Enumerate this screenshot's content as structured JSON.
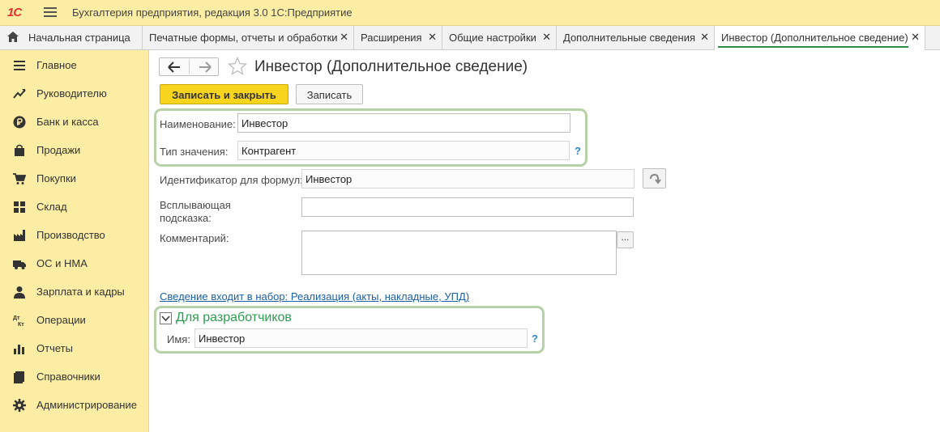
{
  "app": {
    "logo": "1С",
    "title": "Бухгалтерия предприятия, редакция 3.0 1С:Предприятие"
  },
  "tabs": [
    {
      "label": "Начальная страница"
    },
    {
      "label": "Печатные формы, отчеты и обработки"
    },
    {
      "label": "Расширения"
    },
    {
      "label": "Общие настройки"
    },
    {
      "label": "Дополнительные сведения"
    },
    {
      "label": "Инвестор (Дополнительное сведение)"
    }
  ],
  "tab_close_glyph": "✕",
  "sidebar": {
    "items": [
      {
        "label": "Главное",
        "icon": "list-icon"
      },
      {
        "label": "Руководителю",
        "icon": "trend-icon"
      },
      {
        "label": "Банк и касса",
        "icon": "ruble-icon"
      },
      {
        "label": "Продажи",
        "icon": "bag-icon"
      },
      {
        "label": "Покупки",
        "icon": "cart-icon"
      },
      {
        "label": "Склад",
        "icon": "warehouse-icon"
      },
      {
        "label": "Производство",
        "icon": "factory-icon"
      },
      {
        "label": "ОС и НМА",
        "icon": "truck-icon"
      },
      {
        "label": "Зарплата и кадры",
        "icon": "person-icon"
      },
      {
        "label": "Операции",
        "icon": "dt-kt-icon"
      },
      {
        "label": "Отчеты",
        "icon": "bar-chart-icon"
      },
      {
        "label": "Справочники",
        "icon": "book-icon"
      },
      {
        "label": "Администрирование",
        "icon": "gear-icon"
      }
    ],
    "dtkt_top": "Дт",
    "dtkt_bottom": "Кт"
  },
  "form": {
    "title": "Инвестор (Дополнительное сведение)",
    "save_close_label": "Записать и закрыть",
    "save_label": "Записать",
    "name_label": "Наименование:",
    "name_value": "Инвестор",
    "type_label": "Тип значения:",
    "type_value": "Контрагент",
    "help_glyph": "?",
    "formula_id_label": "Идентификатор для формул:",
    "formula_id_value": "Инвестор",
    "tooltip_label_line1": "Всплывающая",
    "tooltip_label_line2": "подсказка:",
    "tooltip_value": "",
    "comment_label": "Комментарий:",
    "comment_value": "",
    "ellipsis_glyph": "...",
    "set_link": "Сведение входит в набор: Реализация (акты, накладные, УПД)",
    "dev_group_title": "Для разработчиков",
    "dev_name_label": "Имя:",
    "dev_name_value": "Инвестор"
  },
  "colors": {
    "accent_yellow": "#f8d41c",
    "panel_yellow": "#fbeda4",
    "highlight_green": "#b6d1a8",
    "group_green": "#2b9d4f",
    "link_blue": "#1a5fa9"
  }
}
